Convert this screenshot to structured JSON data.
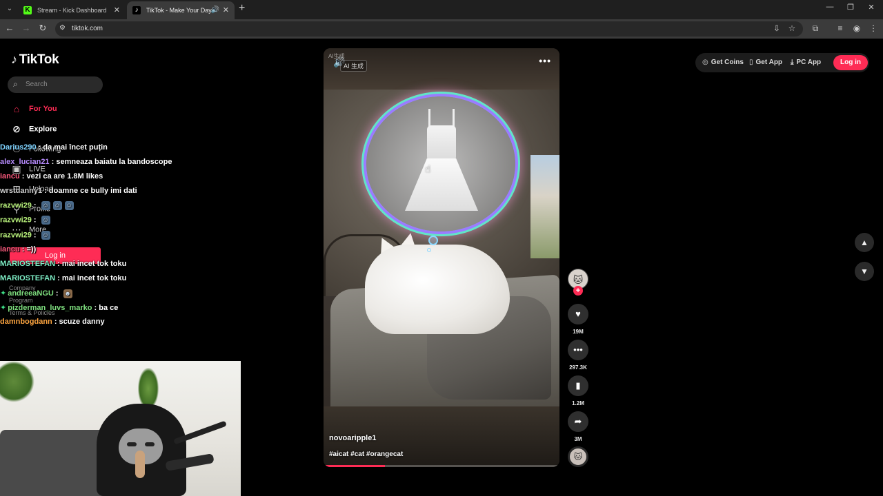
{
  "browser": {
    "tabs": [
      {
        "title": "Stream - Kick Dashboard",
        "favicon": "K"
      },
      {
        "title": "TikTok - Make Your Day",
        "favicon": "♪"
      }
    ],
    "url": "tiktok.com"
  },
  "sidebar": {
    "logo": "TikTok",
    "search_placeholder": "Search",
    "items": [
      {
        "label": "For You"
      },
      {
        "label": "Explore"
      },
      {
        "label": "Following"
      },
      {
        "label": "LIVE"
      },
      {
        "label": "Upload"
      },
      {
        "label": "Profile"
      },
      {
        "label": "More"
      }
    ],
    "login_label": "Log in",
    "footer": [
      "Company",
      "Program",
      "Terms & Policies"
    ]
  },
  "chat": [
    {
      "user": "Darius290",
      "color": "#7fd3ff",
      "text": " : da mai încet puțin"
    },
    {
      "user": "alex_lucian21",
      "color": "#b88cff",
      "text": " : semneaza baiatu la bandoscope"
    },
    {
      "user": "iancu",
      "color": "#ff5b7f",
      "text": " : vezi ca are 1.8M likes"
    },
    {
      "user": "wrstdanny1",
      "color": "#cfcfcf",
      "text": " : doamne ce bully imi dati"
    },
    {
      "user": "razvwi29",
      "color": "#b9f27c",
      "text": " : "
    },
    {
      "user": "razvwi29",
      "color": "#b9f27c",
      "text": " : "
    },
    {
      "user": "razvwi29",
      "color": "#b9f27c",
      "text": " : "
    },
    {
      "user": "iancu",
      "color": "#ff5b7f",
      "text": " : =))"
    },
    {
      "user": "MARIOSTEFAN",
      "color": "#7ff0c7",
      "text": " : mai incet tok toku"
    },
    {
      "user": "MARIOSTEFAN",
      "color": "#7ff0c7",
      "text": " : mai incet tok toku"
    },
    {
      "user": "andreeaNGU",
      "color": "#7fe07f",
      "text": " : "
    },
    {
      "user": "pizderman_luvs_marko",
      "color": "#7fe07f",
      "text": " : ba ce"
    },
    {
      "user": "damnbogdann",
      "color": "#ffa640",
      "text": " : scuze danny"
    }
  ],
  "video": {
    "ai_small": "AI生成",
    "ai_chip": "AI 生成",
    "author": "novoaripple1",
    "tags": "#aicat #cat #orangecat",
    "progress_fraction": 0.26
  },
  "actions": {
    "likes": "19M",
    "comments": "297.3K",
    "saves": "1.2M",
    "shares": "3M"
  },
  "topbar": {
    "get_coins": "Get Coins",
    "get_app": "Get App",
    "pc_app": "PC App",
    "login": "Log in"
  },
  "colors": {
    "brand": "#fe2c55",
    "kick_green": "#53fc18"
  }
}
